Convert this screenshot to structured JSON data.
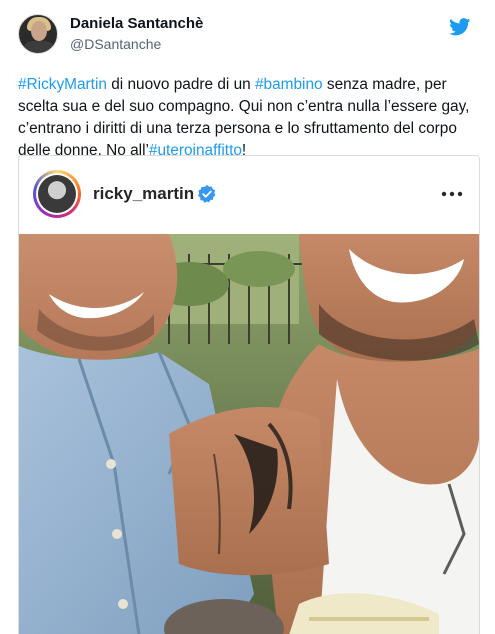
{
  "tweet": {
    "author_name": "Daniela Santanchè",
    "author_handle": "@DSantanche",
    "text_segments": [
      {
        "t": "#RickyMartin",
        "tag": true
      },
      {
        "t": " di nuovo padre di un ",
        "tag": false
      },
      {
        "t": "#bambino",
        "tag": true
      },
      {
        "t": " senza madre, per scelta sua e del suo compagno. Qui non c’entra nulla l’essere gay, c’entrano i diritti di una terza persona e lo sfruttamento del corpo delle donne. No all’",
        "tag": false
      },
      {
        "t": "#uteroinaffitto",
        "tag": true
      },
      {
        "t": "!",
        "tag": false
      }
    ]
  },
  "embed": {
    "username": "ricky_martin",
    "verified": true
  },
  "icons": {
    "brand": "twitter-bird-icon",
    "verified": "verified-badge-icon",
    "more": "more-options-icon"
  },
  "colors": {
    "link": "#1d9bf0",
    "twitter_blue": "#1d9bf0",
    "verified_blue": "#3897f0"
  }
}
